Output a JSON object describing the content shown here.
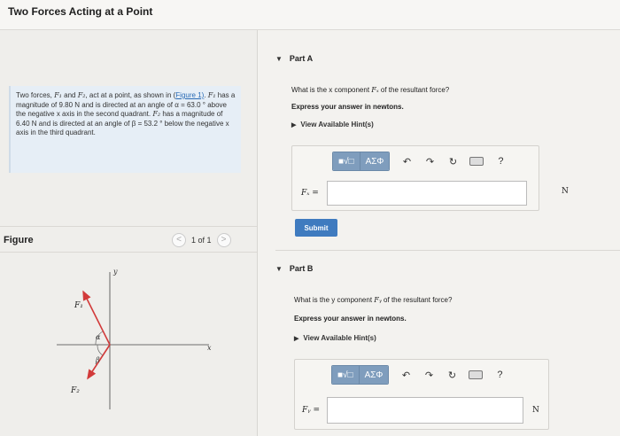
{
  "title": "Two Forces Acting at a Point",
  "problem": {
    "line1_a": "Two forces, ",
    "F1": "F₁",
    "line1_b": " and ",
    "F2": "F₂",
    "line1_c": ", act at a point, as shown in (",
    "link": "Figure 1)",
    "line2_a": ". ",
    "line2_b": " has a magnitude of 9.80 N and is directed at an angle of α = 63.0 ° above the negative x axis in the second quadrant. ",
    "line3": " has a magnitude of 6.40 N and is directed at an angle of β = 53.2 ° below the negative x axis in the third quadrant."
  },
  "figure": {
    "label": "Figure",
    "pager_text": "1 of 1",
    "prev": "<",
    "next": ">",
    "axis_y": "y",
    "axis_x": "x",
    "alpha": "α",
    "beta": "β",
    "f1_label": "F₁",
    "f2_label": "F₂"
  },
  "partA": {
    "heading": "Part A",
    "question_a": "What is the x component ",
    "question_var": "Fₓ",
    "question_b": " of the resultant force?",
    "instruction": "Express your answer in newtons.",
    "hint": "View Available Hint(s)",
    "label": "Fₓ =",
    "value": "",
    "unit": "N",
    "submit": "Submit"
  },
  "partB": {
    "heading": "Part B",
    "question_a": "What is the y component ",
    "question_var": "Fᵧ",
    "question_b": " of the resultant force?",
    "instruction": "Express your answer in newtons.",
    "hint": "View Available Hint(s)",
    "label": "Fᵧ =",
    "value": "",
    "unit": "N"
  },
  "toolbar": {
    "templates": "■√□",
    "symbols": "ΑΣΦ",
    "undo": "↶",
    "redo": "↷",
    "reset": "↻",
    "help": "?"
  },
  "icons": {
    "caret": "caret-down-icon",
    "hint": "triangle-right-icon",
    "undo": "undo-icon",
    "redo": "redo-icon",
    "reset": "reset-icon",
    "keyboard": "keyboard-icon",
    "help": "help-icon"
  },
  "colors": {
    "submit": "#3f7bbf",
    "toolbar": "#7f9dbd",
    "problem_bg": "#e6eef6",
    "arrow": "#d23a3a"
  }
}
